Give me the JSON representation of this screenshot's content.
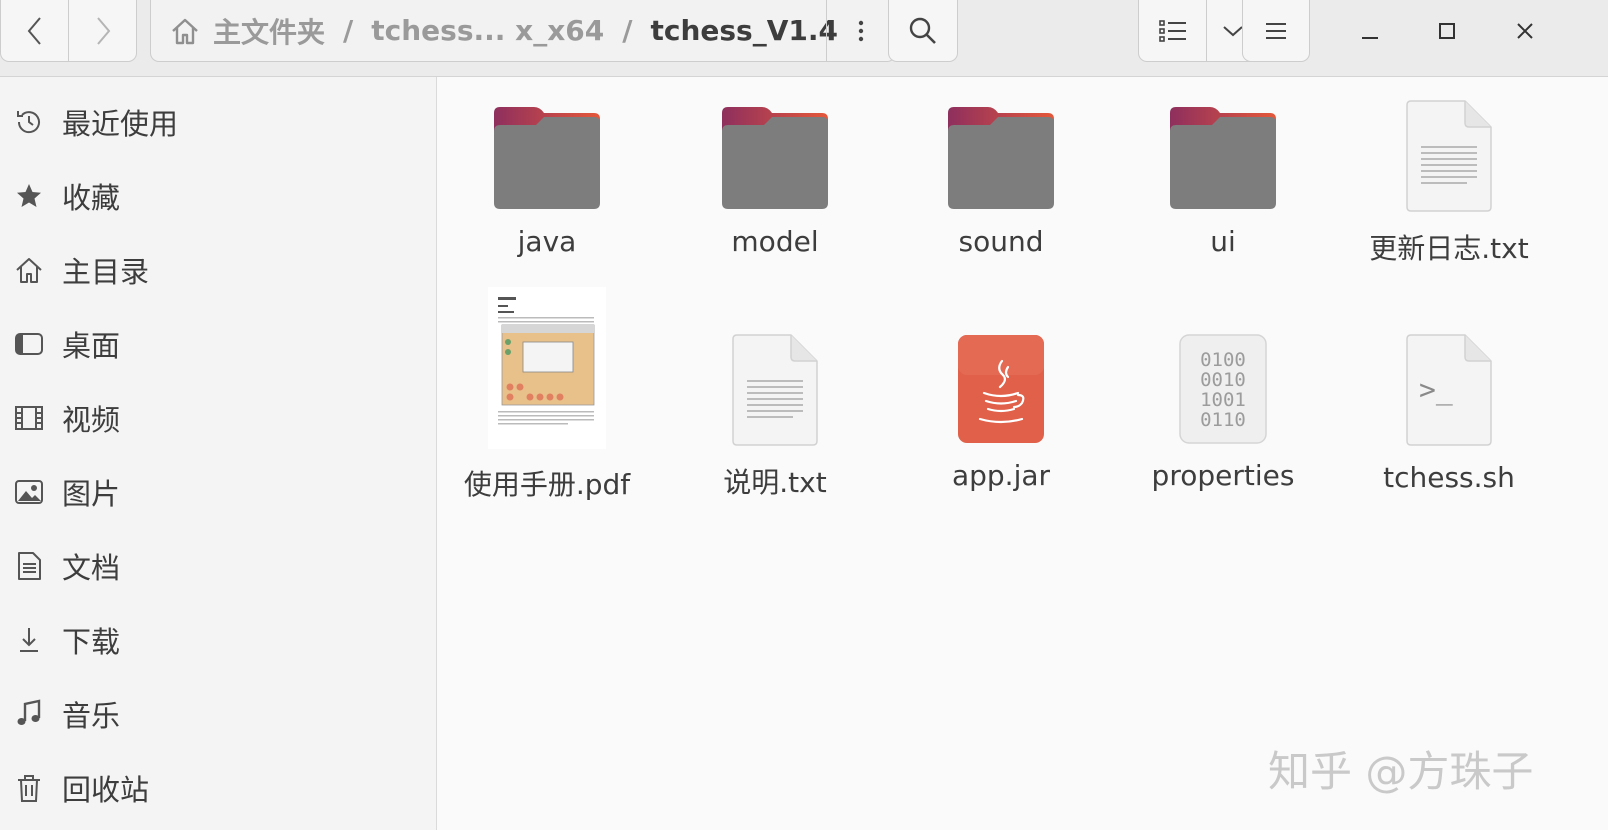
{
  "breadcrumb": [
    "主文件夹",
    "tchess... x_x64",
    "tchess_V1.4"
  ],
  "sidebar": {
    "items": [
      {
        "label": "最近使用",
        "icon": "clock-icon"
      },
      {
        "label": "收藏",
        "icon": "star-icon"
      },
      {
        "label": "主目录",
        "icon": "home-icon"
      },
      {
        "label": "桌面",
        "icon": "desktop-icon"
      },
      {
        "label": "视频",
        "icon": "film-icon"
      },
      {
        "label": "图片",
        "icon": "image-icon"
      },
      {
        "label": "文档",
        "icon": "document-icon"
      },
      {
        "label": "下载",
        "icon": "download-icon"
      },
      {
        "label": "音乐",
        "icon": "music-icon"
      },
      {
        "label": "回收站",
        "icon": "trash-icon"
      }
    ]
  },
  "files": [
    {
      "name": "java",
      "type": "folder"
    },
    {
      "name": "model",
      "type": "folder"
    },
    {
      "name": "sound",
      "type": "folder"
    },
    {
      "name": "ui",
      "type": "folder"
    },
    {
      "name": "更新日志.txt",
      "type": "text"
    },
    {
      "name": "使用手册.pdf",
      "type": "pdf"
    },
    {
      "name": "说明.txt",
      "type": "text"
    },
    {
      "name": "app.jar",
      "type": "jar"
    },
    {
      "name": "properties",
      "type": "binary"
    },
    {
      "name": "tchess.sh",
      "type": "script"
    }
  ],
  "binary_icon_text": [
    "0100",
    "0010",
    "1001",
    "0110"
  ],
  "script_icon_text": ">_",
  "watermark": "知乎 @方珠子",
  "colors": {
    "folder_body": "#7d7d7d",
    "folder_tab_start": "#8e2f5e",
    "folder_tab_end": "#e5583a",
    "jar": "#e0604a"
  }
}
